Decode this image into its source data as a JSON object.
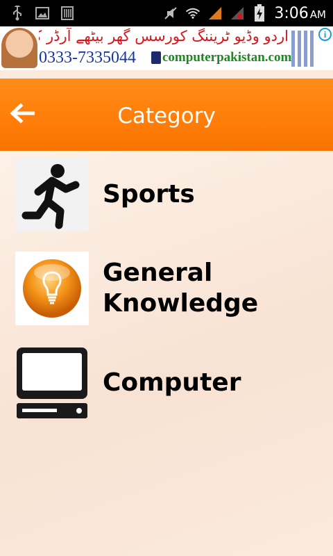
{
  "status_bar": {
    "time": "3:06",
    "ampm": "AM",
    "icons": [
      "usb-icon",
      "image-icon",
      "barcode-icon",
      "mute-icon",
      "wifi-icon",
      "signal-icon",
      "signal-error-icon",
      "battery-charging-icon"
    ]
  },
  "ad": {
    "urdu_text": "اردو وڈیو ٹریننگ کورسس گھر بیٹھے آرڈر کریں",
    "phone": "0333-7335044",
    "site": "computerpakistan.com",
    "info_glyph": "i"
  },
  "app_bar": {
    "title": "Category",
    "back_icon": "arrow-left-icon"
  },
  "categories": [
    {
      "label": "Sports",
      "icon": "running-man-icon"
    },
    {
      "label": "General\nKnowledge",
      "icon": "lightbulb-icon"
    },
    {
      "label": "Computer",
      "icon": "computer-icon"
    }
  ],
  "colors": {
    "app_bar": "#ff8010",
    "status_bar": "#000000",
    "ad_urdu": "#d9151b",
    "ad_phone": "#1833a6",
    "ad_site": "#1a8a1f"
  }
}
